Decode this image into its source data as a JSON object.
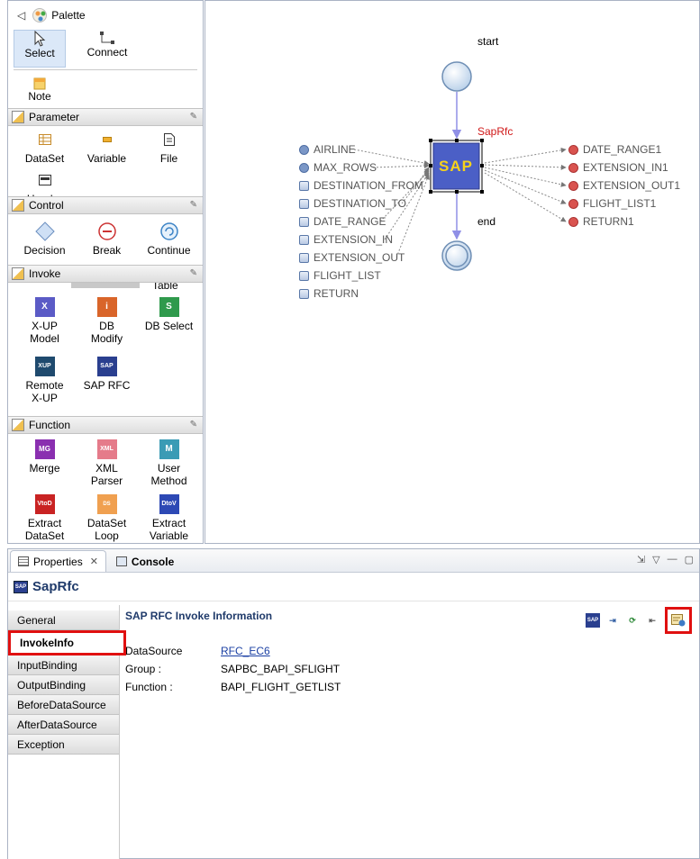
{
  "palette": {
    "title": "Palette",
    "tools": [
      {
        "label": "Select",
        "icon": "cursor-icon"
      },
      {
        "label": "Connect",
        "icon": "connect-icon"
      }
    ],
    "note": {
      "label": "Note",
      "icon": "note-icon"
    },
    "drawers": {
      "parameter": {
        "title": "Parameter",
        "items": [
          "DataSet",
          "Variable",
          "File",
          "Header"
        ]
      },
      "control": {
        "title": "Control",
        "items": [
          "Decision",
          "Break",
          "Continue"
        ]
      },
      "invoke": {
        "title": "Invoke",
        "items": [
          "X-UP Model",
          "DB Modify",
          "DB Select",
          "Remote X-UP",
          "SAP RFC"
        ],
        "clipped_label": "Table"
      },
      "function": {
        "title": "Function",
        "items": [
          "Merge",
          "XML Parser",
          "User Method",
          "Extract DataSet",
          "DataSet Loop",
          "Extract Variable"
        ]
      }
    }
  },
  "canvas": {
    "start_label": "start",
    "end_label": "end",
    "node_label": "SapRfc",
    "node_text": "SAP",
    "inputs": [
      "AIRLINE",
      "MAX_ROWS",
      "DESTINATION_FROM",
      "DESTINATION_TO",
      "DATE_RANGE",
      "EXTENSION_IN",
      "EXTENSION_OUT",
      "FLIGHT_LIST",
      "RETURN"
    ],
    "outputs": [
      "DATE_RANGE1",
      "EXTENSION_IN1",
      "EXTENSION_OUT1",
      "FLIGHT_LIST1",
      "RETURN1"
    ],
    "colors": {
      "node_fill": "#4b5fc6",
      "node_text": "#f5d21c",
      "arrow": "#8f8fe6",
      "label_red": "#d01818"
    }
  },
  "properties": {
    "tab_properties": "Properties",
    "tab_console": "Console",
    "title": "SapRfc",
    "side_tabs": [
      "General",
      "InvokeInfo",
      "InputBinding",
      "OutputBinding",
      "BeforeDataSource",
      "AfterDataSource",
      "Exception"
    ],
    "section_title": "SAP RFC Invoke Information",
    "rows": [
      {
        "label": "DataSource",
        "value": "RFC_EC6"
      },
      {
        "label": "Group :",
        "value": "SAPBC_BAPI_SFLIGHT"
      },
      {
        "label": "Function :",
        "value": "BAPI_FLIGHT_GETLIST"
      }
    ]
  }
}
